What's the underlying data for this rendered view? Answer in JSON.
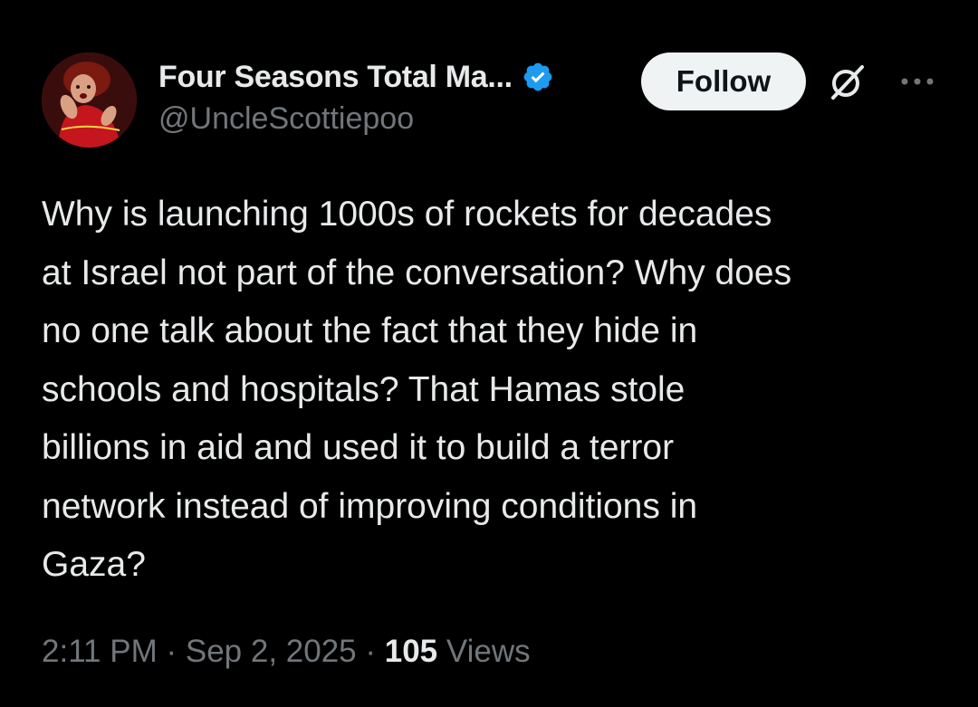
{
  "author": {
    "display_name": "Four Seasons Total Ma...",
    "handle": "@UncleScottiepoo",
    "verified": true,
    "avatar": "profile-photo"
  },
  "actions": {
    "follow_label": "Follow",
    "grok_icon": "grok-icon",
    "more_icon": "more-horizontal-icon"
  },
  "tweet": {
    "text": "Why is launching 1000s of rockets for decades\nat Israel not part of the conversation? Why does\nno one talk about the fact that they hide in\nschools and hospitals? That Hamas stole\nbillions in aid and used it to build a terror\nnetwork instead of improving conditions in\nGaza?"
  },
  "meta": {
    "time": "2:11 PM",
    "separator": " · ",
    "date": "Sep 2, 2025",
    "views_count": "105",
    "views_label": " Views"
  },
  "colors": {
    "background": "#000000",
    "text": "#e7e9ea",
    "secondary": "#71767b",
    "verified_blue": "#1d9bf0",
    "button_bg": "#eff3f4"
  }
}
